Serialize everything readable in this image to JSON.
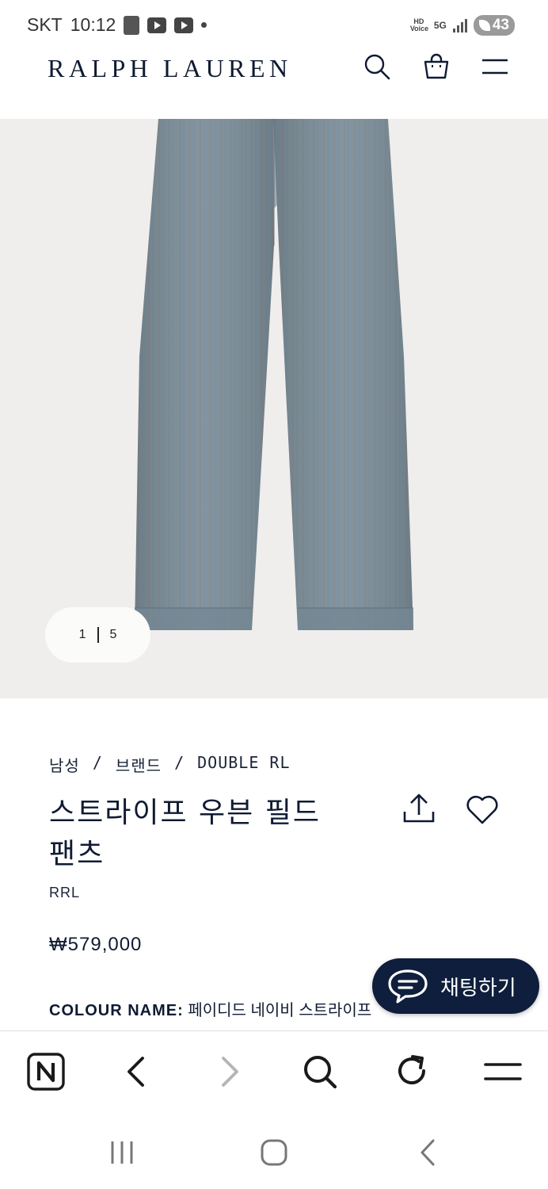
{
  "status_bar": {
    "carrier": "SKT",
    "time": "10:12",
    "hd_voice": "HD Voice",
    "network": "5G",
    "battery": "43"
  },
  "header": {
    "logo": "RALPH LAUREN"
  },
  "gallery": {
    "current_page": "1",
    "total_pages": "5"
  },
  "product": {
    "breadcrumb": [
      "남성",
      "브랜드",
      "DOUBLE RL"
    ],
    "breadcrumb_separator": "/",
    "title": "스트라이프 우븐 필드 팬츠",
    "brand": "RRL",
    "price": "₩579,000",
    "colour_label": "COLOUR NAME:",
    "colour_value": "페이디드 네이비 스트라이프"
  },
  "chat": {
    "label": "채팅하기"
  },
  "colors": {
    "navy": "#0f1b33",
    "chat_bg": "#0e1e3c",
    "gallery_bg": "#efeeed",
    "pants": "#7a8d99"
  }
}
